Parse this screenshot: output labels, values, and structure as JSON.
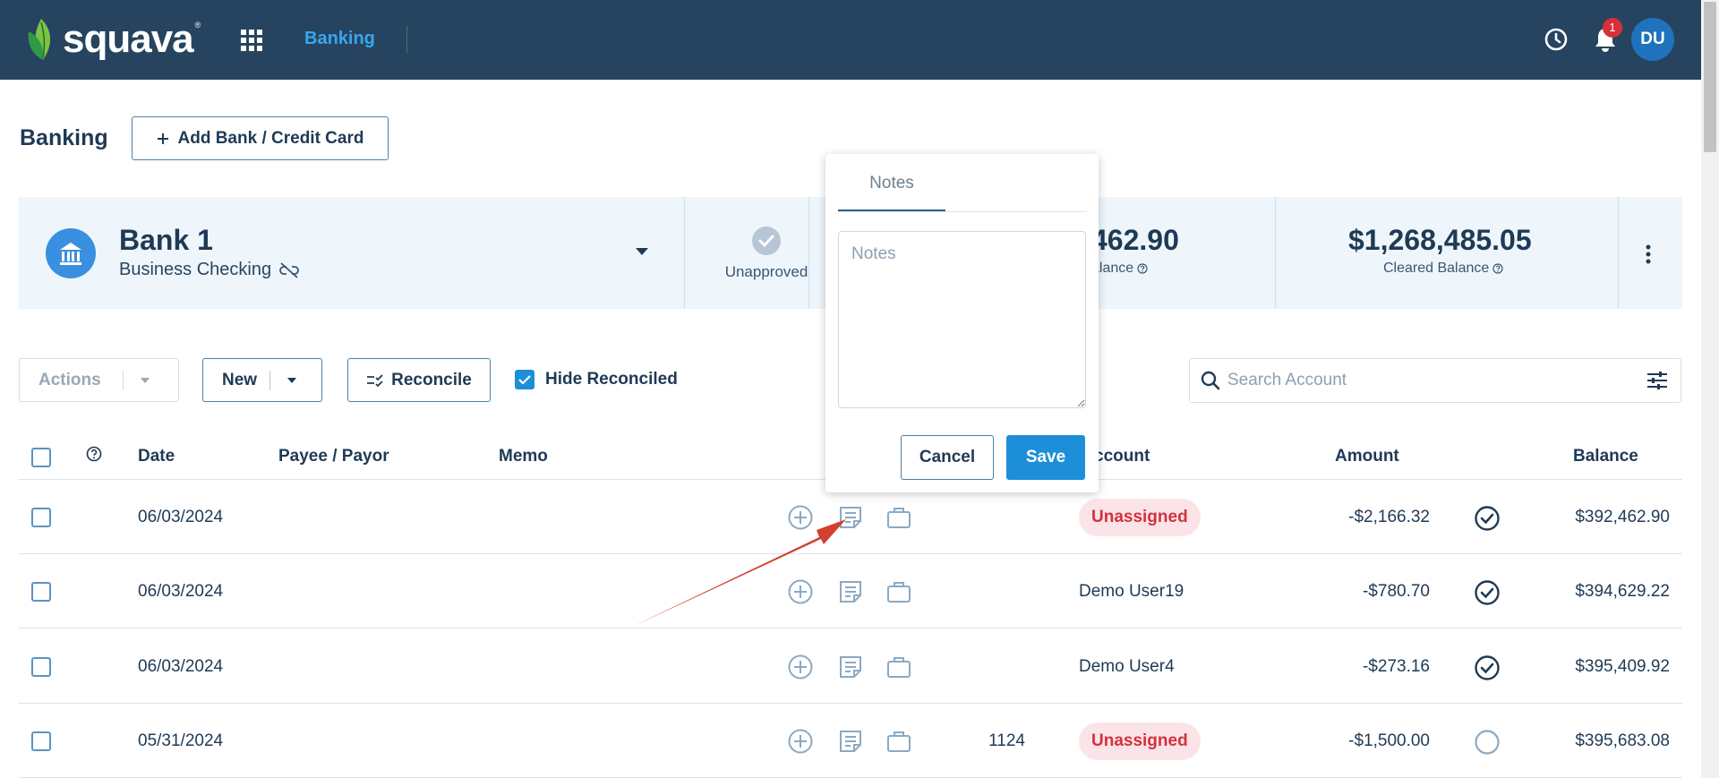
{
  "brand": {
    "name": "squava",
    "tm": "®"
  },
  "nav": {
    "active": "Banking"
  },
  "header": {
    "notifications_count": "1",
    "avatar_initials": "DU"
  },
  "page": {
    "title": "Banking",
    "add_bank_label": "Add Bank / Credit Card"
  },
  "account": {
    "name": "Bank 1",
    "type": "Business Checking",
    "unapproved_label": "Unapproved",
    "balance_value": "462.90",
    "balance_label": "alance",
    "cleared_balance_value": "$1,268,485.05",
    "cleared_balance_label": "Cleared Balance"
  },
  "toolbar": {
    "actions_label": "Actions",
    "new_label": "New",
    "reconcile_label": "Reconcile",
    "hide_reconciled_label": "Hide Reconciled",
    "hide_reconciled_checked": true,
    "search_placeholder": "Search Account"
  },
  "table": {
    "headers": {
      "date": "Date",
      "payee": "Payee / Payor",
      "memo": "Memo",
      "account": "ccount",
      "amount": "Amount",
      "balance": "Balance"
    },
    "rows": [
      {
        "date": "06/03/2024",
        "number": "",
        "account": "Unassigned",
        "unassigned": true,
        "amount": "-$2,166.32",
        "cleared": true,
        "balance": "$392,462.90"
      },
      {
        "date": "06/03/2024",
        "number": "",
        "account": "Demo User19",
        "unassigned": false,
        "amount": "-$780.70",
        "cleared": true,
        "balance": "$394,629.22"
      },
      {
        "date": "06/03/2024",
        "number": "",
        "account": "Demo User4",
        "unassigned": false,
        "amount": "-$273.16",
        "cleared": true,
        "balance": "$395,409.92"
      },
      {
        "date": "05/31/2024",
        "number": "1124",
        "account": "Unassigned",
        "unassigned": true,
        "amount": "-$1,500.00",
        "cleared": false,
        "balance": "$395,683.08"
      }
    ]
  },
  "notes_popover": {
    "tab_label": "Notes",
    "placeholder": "Notes",
    "value": "",
    "cancel_label": "Cancel",
    "save_label": "Save"
  },
  "colors": {
    "topbar": "#26445f",
    "accent": "#1d8fd8",
    "unassigned_text": "#d5303f",
    "unassigned_bg": "#fbe4e7",
    "annotation_arrow": "#d2402f"
  }
}
